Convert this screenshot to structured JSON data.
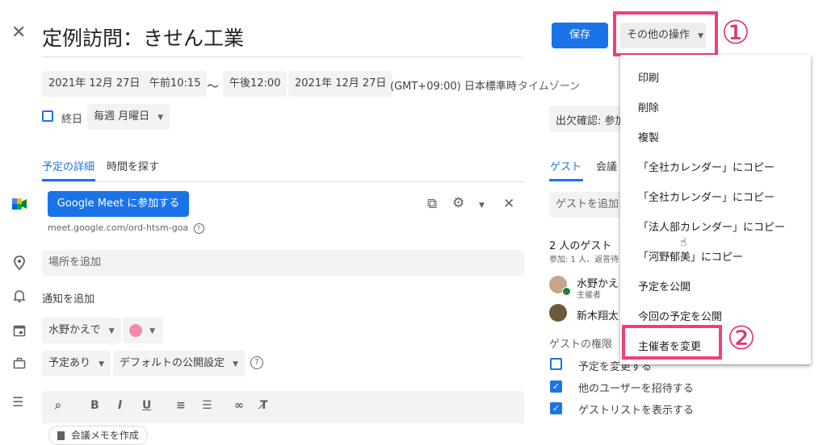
{
  "header": {
    "title": "定例訪問：きせん工業",
    "save_label": "保存",
    "other_actions_label": "その他の操作",
    "annotation_1": "①",
    "annotation_2": "②"
  },
  "datetime": {
    "start_date": "2021年 12月 27日",
    "start_time": "午前10:15",
    "separator": "〜",
    "end_time": "午後12:00",
    "end_date": "2021年 12月 27日",
    "timezone": "(GMT+09:00) 日本標準時",
    "timezone_link": "タイムゾーン"
  },
  "options": {
    "all_day_label": "終日",
    "repeat_label": "毎週 月曜日"
  },
  "tabs": {
    "details": "予定の詳細",
    "find_time": "時間を探す",
    "guests": "ゲスト",
    "rooms": "会議"
  },
  "meet": {
    "join_button": "Google Meet に参加する",
    "link": "meet.google.com/ord-htsm-goa"
  },
  "fields": {
    "location_placeholder": "場所を追加",
    "notification_label": "通知を追加",
    "calendar_owner": "水野かえで",
    "availability": "予定あり",
    "visibility": "デフォルトの公開設定"
  },
  "rsvp": {
    "label": "出欠確認: 参加"
  },
  "guests": {
    "add_placeholder": "ゲストを追加",
    "count_label": "2 人のゲスト",
    "summary": "参加: 1 人、返答待",
    "list": [
      {
        "name": "水野かえ",
        "role": "主催者"
      },
      {
        "name": "新木翔太",
        "role": ""
      }
    ],
    "permissions_title": "ゲストの権限",
    "permissions": [
      {
        "label": "予定を変更する",
        "checked": false
      },
      {
        "label": "他のユーザーを招待する",
        "checked": true
      },
      {
        "label": "ゲストリストを表示する",
        "checked": true
      }
    ]
  },
  "menu": {
    "items": [
      "印刷",
      "削除",
      "複製",
      "「全社カレンダー」にコピー",
      "「全社カレンダー」にコピー",
      "「法人部カレンダー」にコピー",
      "「河野郁美」にコピー",
      "予定を公開",
      "今回の予定を公開",
      "主催者を変更"
    ]
  },
  "editor": {
    "meeting_notes_label": "会議メモを作成"
  },
  "colors": {
    "primary_blue": "#1a73e8",
    "highlight_pink": "#f0407c",
    "event_color": "#f28baa"
  }
}
